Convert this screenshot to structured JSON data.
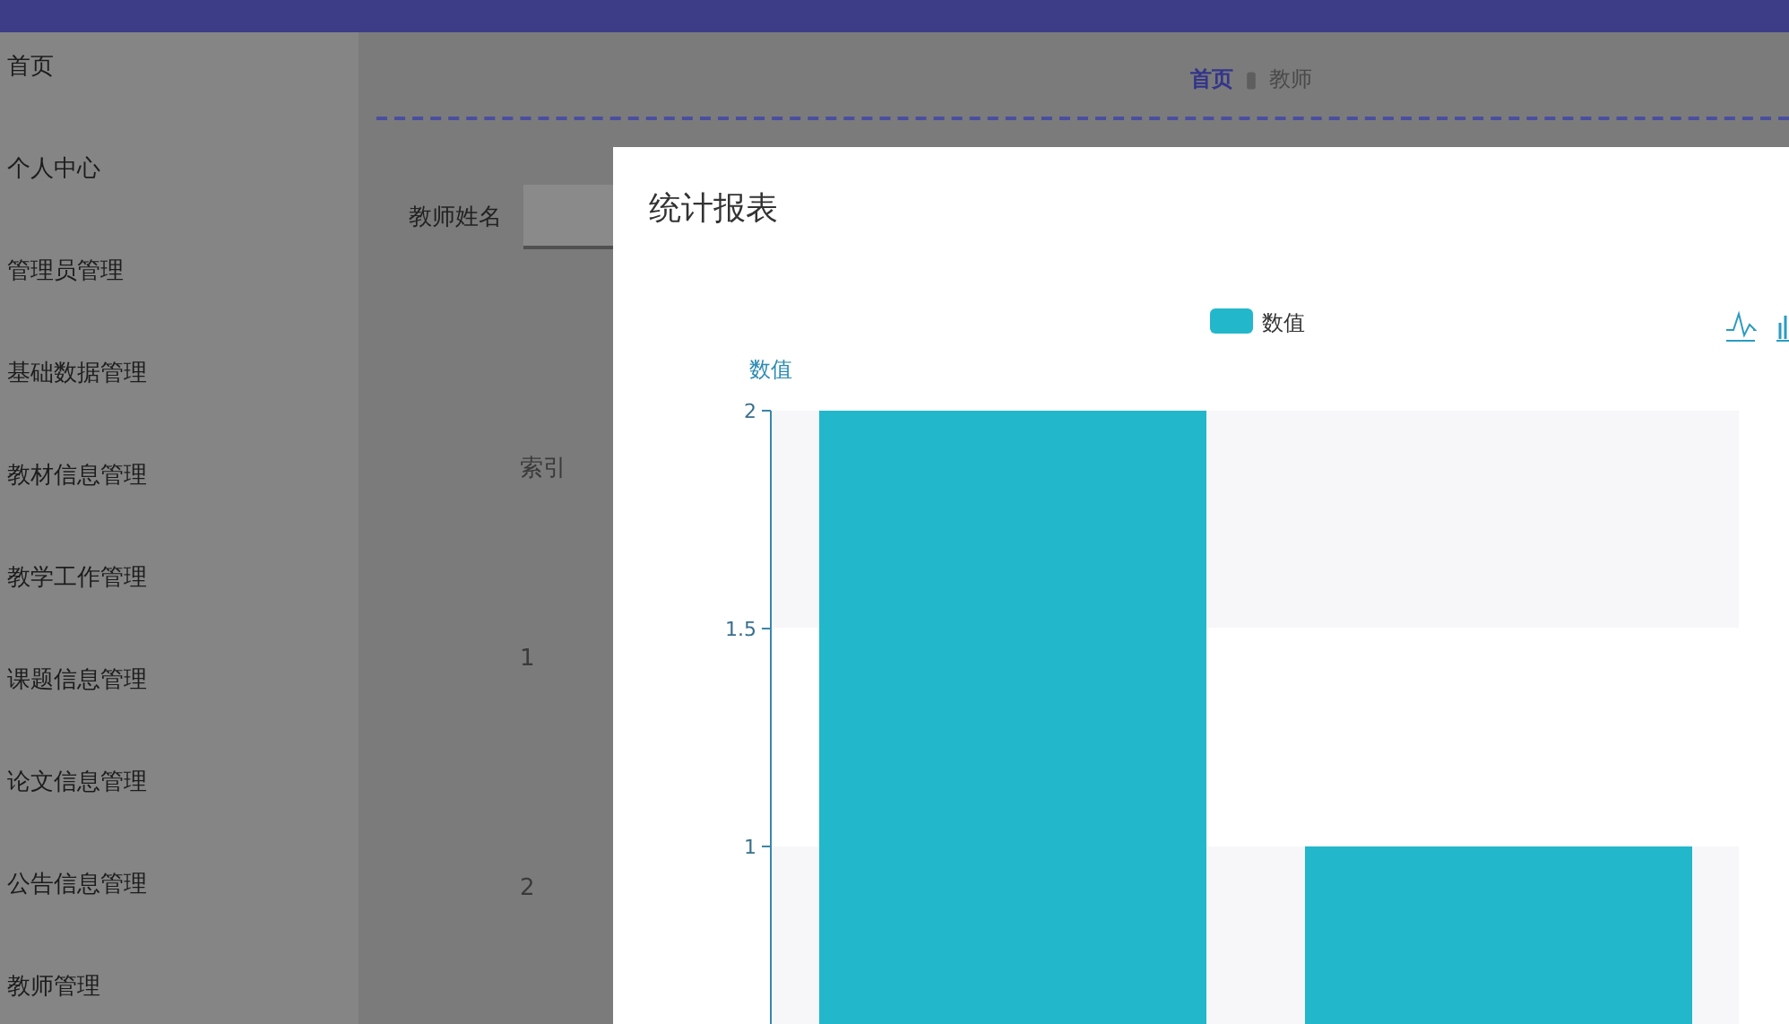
{
  "sidebar": {
    "items": [
      {
        "label": "首页"
      },
      {
        "label": "个人中心"
      },
      {
        "label": "管理员管理"
      },
      {
        "label": "基础数据管理"
      },
      {
        "label": "教材信息管理"
      },
      {
        "label": "教学工作管理"
      },
      {
        "label": "课题信息管理"
      },
      {
        "label": "论文信息管理"
      },
      {
        "label": "公告信息管理"
      },
      {
        "label": "教师管理"
      }
    ]
  },
  "breadcrumb": [
    {
      "label": "首页",
      "selected": true
    },
    {
      "label": "教师",
      "selected": false
    }
  ],
  "search": {
    "label": "教师姓名"
  },
  "table": {
    "columns": [
      "索引"
    ],
    "rows": [
      [
        "1"
      ],
      [
        "2"
      ]
    ]
  },
  "dialog": {
    "title": "统计报表",
    "chart_data": {
      "type": "bar",
      "ylabel": "数值",
      "series": [
        {
          "name": "数值",
          "color": "#23b7cb",
          "values": [
            2,
            1
          ]
        }
      ],
      "ylim": [
        0,
        2
      ],
      "yticks": [
        1,
        1.5,
        2
      ]
    }
  }
}
